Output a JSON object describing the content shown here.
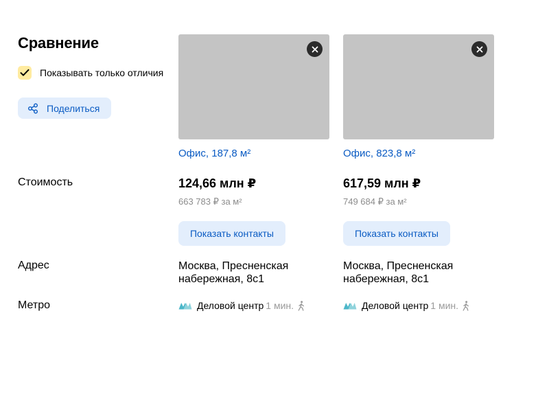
{
  "page": {
    "title": "Сравнение",
    "show_only_differences_label": "Показывать только отличия",
    "show_only_differences_checked": true,
    "share_label": "Поделиться"
  },
  "labels": {
    "cost": "Стоимость",
    "address": "Адрес",
    "metro": "Метро"
  },
  "colors": {
    "accent": "#0a5bc3",
    "button_bg": "#e3eefc",
    "checkbox_bg": "#ffeba0",
    "photo_placeholder": "#c4c4c4",
    "metro_line": "#4cb7c9"
  },
  "offers": [
    {
      "title": "Офис, 187,8 м²",
      "price": "124,66 млн ₽",
      "price_per_sqm": "663 783 ₽ за м²",
      "contacts_label": "Показать контакты",
      "address": "Москва, Пресненская набережная, 8с1",
      "metro_station": "Деловой центр",
      "metro_time": "1 мин.",
      "metro_transport_icon": "walk-icon"
    },
    {
      "title": "Офис, 823,8 м²",
      "price": "617,59 млн ₽",
      "price_per_sqm": "749 684 ₽ за м²",
      "contacts_label": "Показать контакты",
      "address": "Москва, Пресненская набережная, 8с1",
      "metro_station": "Деловой центр",
      "metro_time": "1 мин.",
      "metro_transport_icon": "walk-icon"
    }
  ]
}
